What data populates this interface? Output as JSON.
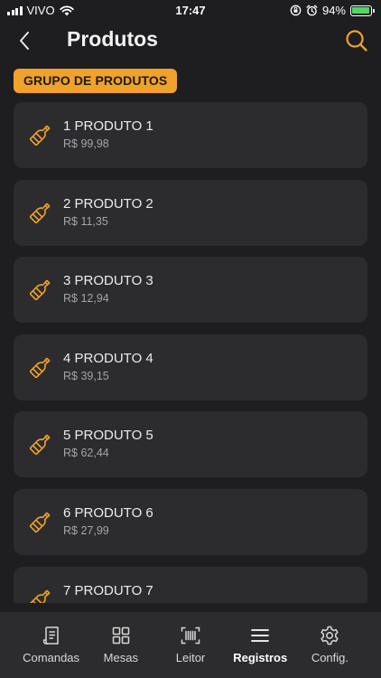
{
  "status_bar": {
    "carrier": "VIVO",
    "time": "17:47",
    "battery": "94%",
    "battery_level": 0.94
  },
  "header": {
    "title": "Produtos"
  },
  "group": {
    "label": "GRUPO DE PRODUTOS"
  },
  "colors": {
    "accent": "#f0a22b",
    "background": "#1e1e20",
    "card": "#2c2c2e"
  },
  "products": [
    {
      "name": "1 PRODUTO 1",
      "price": "R$ 99,98"
    },
    {
      "name": "2 PRODUTO 2",
      "price": "R$ 11,35"
    },
    {
      "name": "3 PRODUTO 3",
      "price": "R$ 12,94"
    },
    {
      "name": "4 PRODUTO 4",
      "price": "R$ 39,15"
    },
    {
      "name": "5 PRODUTO 5",
      "price": "R$ 62,44"
    },
    {
      "name": "6 PRODUTO 6",
      "price": "R$ 27,99"
    },
    {
      "name": "7 PRODUTO 7",
      "price": ""
    }
  ],
  "tabs": [
    {
      "label": "Comandas",
      "icon": "receipt-icon"
    },
    {
      "label": "Mesas",
      "icon": "grid-icon"
    },
    {
      "label": "Leitor",
      "icon": "barcode-icon"
    },
    {
      "label": "Registros",
      "icon": "menu-icon"
    },
    {
      "label": "Config.",
      "icon": "gear-icon"
    }
  ]
}
